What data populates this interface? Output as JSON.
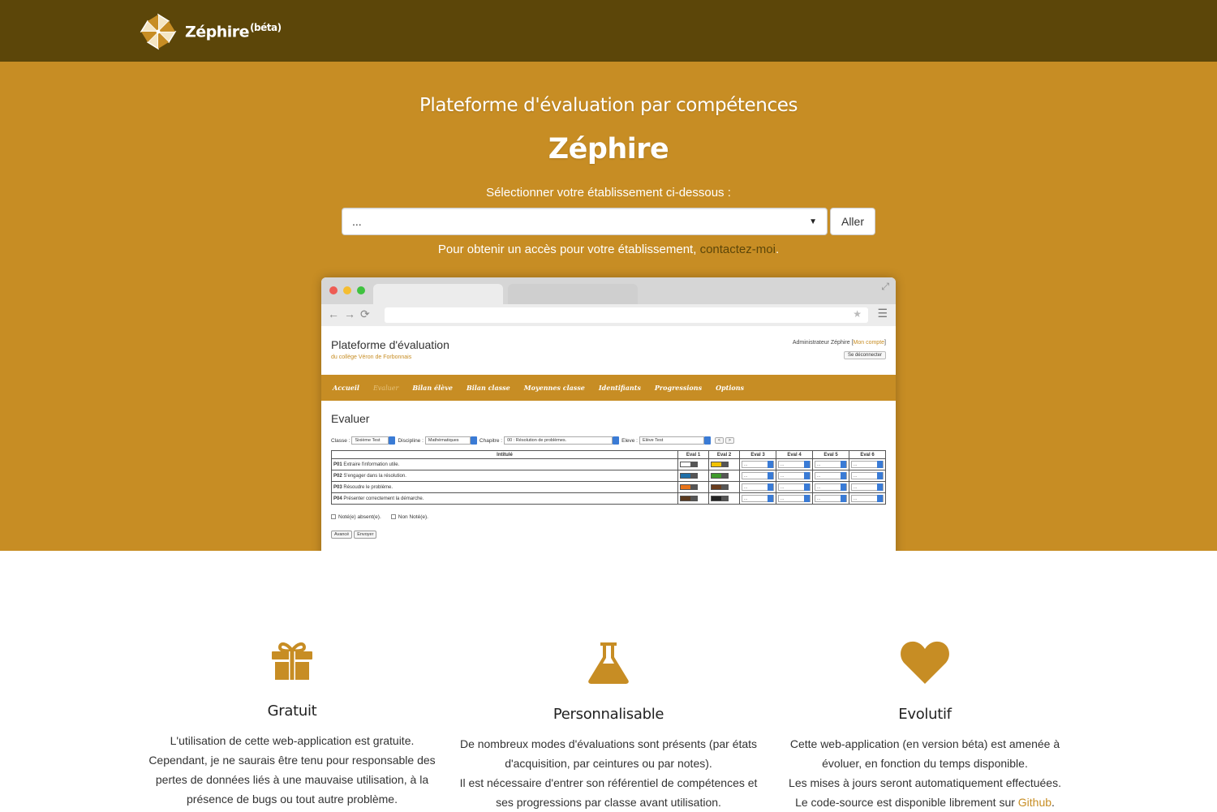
{
  "navbar": {
    "brand": "Zéphire",
    "beta": "(béta)"
  },
  "hero": {
    "subtitle": "Plateforme d'évaluation par compétences",
    "title": "Zéphire",
    "select_label": "Sélectionner votre établissement ci-dessous :",
    "select_value": "...",
    "go_button": "Aller",
    "access_text": "Pour obtenir un accès pour votre établissement, ",
    "access_link": "contactez-moi",
    "access_end": "."
  },
  "mockup": {
    "app_title": "Plateforme d'évaluation",
    "app_subtitle": "du collège Véron de Forbonnais",
    "admin_text": "Administrateur Zéphire [",
    "account_link": "Mon compte",
    "admin_end": "]",
    "logout": "Se déconnecter",
    "menu": [
      "Accueil",
      "Evaluer",
      "Bilan élève",
      "Bilan classe",
      "Moyennes classe",
      "Identifiants",
      "Progressions",
      "Options"
    ],
    "page_title": "Evaluer",
    "filters": {
      "classe_label": "Classe :",
      "classe_value": "Sixième Test",
      "discipline_label": "Discipline :",
      "discipline_value": "Mathématiques",
      "chapitre_label": "Chapitre :",
      "chapitre_value": "00 : Résolution de problèmes.",
      "eleve_label": "Eleve :",
      "eleve_value": "Elève Test",
      "prev": "<",
      "next": ">"
    },
    "table": {
      "headers": [
        "Intitulé",
        "Eval 1",
        "Eval 2",
        "Eval 3",
        "Eval 4",
        "Eval 5",
        "Eval 6"
      ],
      "rows": [
        {
          "code": "P01",
          "label": "Extraire l'information utile.",
          "c1": "#ffffff",
          "c2": "#f2c200"
        },
        {
          "code": "P02",
          "label": "S'engager dans la résolution.",
          "c1": "#1f6fa8",
          "c2": "#3f9a2c"
        },
        {
          "code": "P03",
          "label": "Résoudre le problème.",
          "c1": "#e8741a",
          "c2": "#6a3d1e"
        },
        {
          "code": "P04",
          "label": "Présenter correctement la démarche.",
          "c1": "#5b3a1e",
          "c2": "#222222"
        }
      ],
      "empty_cell": "..."
    },
    "absent": "Noté(e) absent(e).",
    "not_noted": "Non Noté(e).",
    "btn_advanced": "Avancé",
    "btn_send": "Envoyer"
  },
  "features": [
    {
      "icon": "gift-icon",
      "title": "Gratuit",
      "lines": [
        "L'utilisation de cette web-application est gratuite.",
        "Cependant, je ne saurais être tenu pour responsable des",
        "pertes de données liés à une mauvaise utilisation, à la",
        "présence de bugs ou tout autre problème."
      ]
    },
    {
      "icon": "flask-icon",
      "title": "Personnalisable",
      "lines": [
        "De nombreux modes d'évaluations sont présents (par états",
        "d'acquisition, par ceintures ou par notes).",
        "Il est nécessaire d'entrer son référentiel de compétences et",
        "ses progressions par classe avant utilisation."
      ]
    },
    {
      "icon": "heart-icon",
      "title": "Evolutif",
      "lines": [
        "Cette web-application (en version béta) est amenée à",
        "évoluer, en fonction du temps disponible.",
        "Les mises à jours seront automatiquement effectuées.",
        "Le code-source est disponible librement sur "
      ],
      "link": "Github",
      "link_end": "."
    }
  ],
  "colors": {
    "navbar": "#5c4609",
    "accent": "#c78d24"
  }
}
